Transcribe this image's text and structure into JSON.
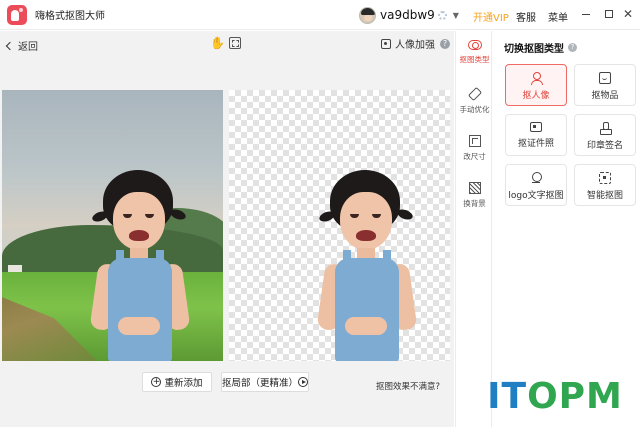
{
  "app": {
    "title": "嗨格式抠图大师"
  },
  "user": {
    "name": "va9dbw9"
  },
  "titlebar": {
    "vip_label": "开通VIP",
    "service_label": "客服",
    "menu_label": "菜单",
    "close_glyph": "✕"
  },
  "toolbar": {
    "back_label": "返回",
    "enhance_label": "人像加强",
    "help_glyph": "?"
  },
  "actions": {
    "add_label": "重新添加",
    "local_label": "抠局部（更精准）",
    "unsatisfied_label": "抠图效果不满意?"
  },
  "rail": {
    "items": [
      {
        "label": "抠图类型",
        "icon": "cutout-icon",
        "active": true
      },
      {
        "label": "手动优化",
        "icon": "eraser-icon",
        "active": false
      },
      {
        "label": "改尺寸",
        "icon": "resize-icon",
        "active": false
      },
      {
        "label": "换背景",
        "icon": "background-icon",
        "active": false
      }
    ]
  },
  "side": {
    "title": "切换抠图类型",
    "help_glyph": "?",
    "cards": [
      {
        "label": "抠人像",
        "icon": "person-icon",
        "active": true
      },
      {
        "label": "抠物品",
        "icon": "box-icon",
        "active": false
      },
      {
        "label": "抠证件照",
        "icon": "id-photo-icon",
        "active": false
      },
      {
        "label": "印章签名",
        "icon": "stamp-icon",
        "active": false
      },
      {
        "label": "logo文字抠图",
        "icon": "logo-icon",
        "active": false
      },
      {
        "label": "智能抠图",
        "icon": "smart-cutout-icon",
        "active": false
      }
    ]
  },
  "watermark": {
    "part1": "IT",
    "part2": "OPM"
  },
  "colors": {
    "accent": "#e0433b",
    "vip": "#f7a31c",
    "watermark_blue": "#1f7fc2",
    "watermark_green": "#2fa64f"
  }
}
